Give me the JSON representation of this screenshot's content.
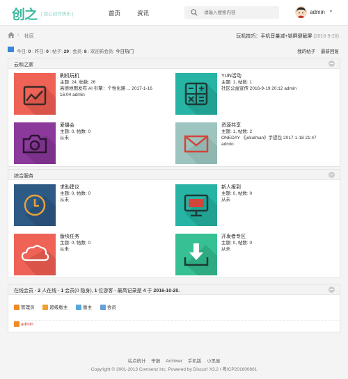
{
  "header": {
    "logo": "创之",
    "slogan": "[ 用心创作快乐 ]",
    "nav": [
      "首页",
      "资讯"
    ],
    "search_placeholder": "请输入搜索内容",
    "username": "admin",
    "caret": "▾"
  },
  "breadcrumb": {
    "separator": "›",
    "current": "社区",
    "tip_text": "玩机技巧：手机音量减+锁屏键截屏",
    "tip_date": "(2016-9-20)"
  },
  "stats": {
    "today_label": "今日:",
    "today": "0",
    "yesterday_label": "昨日:",
    "yesterday": "0",
    "posts_label": "帖子:",
    "posts": "29",
    "members_label": "会员:",
    "members": "8",
    "welcome": "欢迎新会员:",
    "hot": "今日热门",
    "my_posts": "我的帖子",
    "latest": "最新回复"
  },
  "sections": [
    {
      "title": "云和之家",
      "forums": [
        {
          "name": "刷机玩机",
          "stats": "主题: 24, 帖数: 26",
          "last_line1": "高德地图发布 AI 引擎：个性化路 ... 2017-1-16",
          "last_line2": "16:04 admin",
          "color": "#ef6357",
          "icon": "chart-icon"
        },
        {
          "name": "YUN活动",
          "stats": "主题: 1, 帖数: 1",
          "last_line1": "社区公益宣传 2016-9-19 20:12 admin",
          "last_line2": "",
          "color": "#27b4a4",
          "icon": "calculator-icon"
        },
        {
          "name": "爱摄会",
          "stats": "主题: 0, 帖数: 0",
          "last_line1": "从未",
          "last_line2": "",
          "color": "#8b3a9b",
          "icon": "camera-icon"
        },
        {
          "name": "资源共享",
          "stats": "主题: 1, 帖数: 2",
          "last_line1": "ONEDAY 《jokulman》手提包 2017-1-18 21:47",
          "last_line2": "admin",
          "color": "#9ec4bf",
          "icon": "mail-icon"
        }
      ]
    },
    {
      "title": "综合服务",
      "forums": [
        {
          "name": "求助建议",
          "stats": "主题: 0, 帖数: 0",
          "last_line1": "从未",
          "last_line2": "",
          "color": "#2e5a86",
          "icon": "clock-icon"
        },
        {
          "name": "新人报到",
          "stats": "主题: 0, 帖数: 0",
          "last_line1": "从未",
          "last_line2": "",
          "color": "#27b4a4",
          "icon": "monitor-icon"
        },
        {
          "name": "版块任务",
          "stats": "主题: 0, 帖数: 0",
          "last_line1": "从未",
          "last_line2": "",
          "color": "#ef6357",
          "icon": "cloud-icon"
        },
        {
          "name": "开发者专区",
          "stats": "主题: 0, 帖数: 0",
          "last_line1": "从未",
          "last_line2": "",
          "color": "#36c093",
          "icon": "download-icon"
        }
      ]
    }
  ],
  "online": {
    "prefix": "在线会员 - ",
    "online_count": "2",
    "text1": " 人在线 - ",
    "member_count": "1",
    "text2": " 会员(",
    "hidden_count": "0",
    "text3": " 隐身), ",
    "guest_count": "1",
    "text4": " 位游客 - 最高记录是 ",
    "record": "4",
    "text5": " 于 ",
    "record_date": "2016-10-20.",
    "legend": [
      "管理员",
      "超级版主",
      "版主",
      "会员"
    ],
    "legend_colors": [
      "#f08a24",
      "#f0a030",
      "#56a7e0",
      "#68a0d8"
    ],
    "users": [
      "admin"
    ]
  },
  "footer": {
    "links": [
      "站点统计",
      "举报",
      "Archiver",
      "手机版",
      "小黑屋"
    ],
    "copyright": "Copyright © 2001-2013 Comsenz Inc. Powered by Discuz! X3.2 / 粤ICP201600801"
  }
}
